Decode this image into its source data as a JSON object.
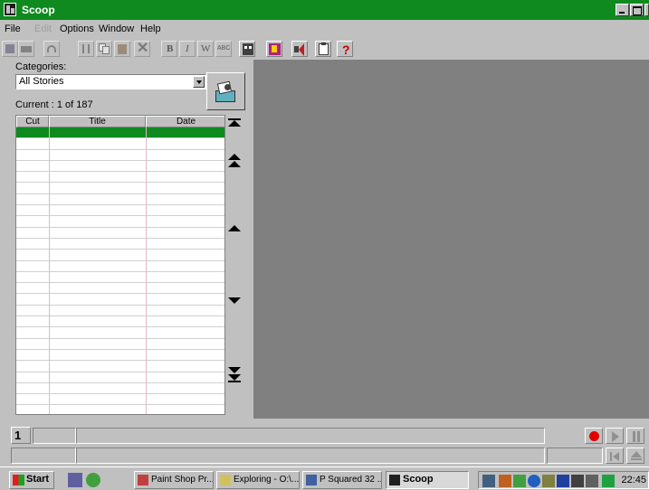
{
  "window": {
    "title": "Scoop"
  },
  "menu": {
    "file": "File",
    "edit": "Edit",
    "options": "Options",
    "window": "Window",
    "help": "Help"
  },
  "toolbar": {
    "buttons": [
      "save-icon",
      "print-icon",
      "undo-icon",
      "cut-icon",
      "copy-icon",
      "paste-icon",
      "delete-icon",
      "bold-icon",
      "italic-icon",
      "word-icon",
      "spell-icon",
      "building-icon",
      "book-icon",
      "speaker-icon",
      "clipboard-icon",
      "help-icon"
    ],
    "bold_glyph": "B",
    "italic_glyph": "I",
    "word_glyph": "W",
    "spell_glyph": "ABC",
    "help_glyph": "?"
  },
  "left_panel": {
    "categories_label": "Categories:",
    "category_value": "All Stories",
    "current_label": "Current : 1 of 187",
    "columns": [
      "Cut",
      "Title",
      "Date"
    ],
    "row_count": 25,
    "selected_row": 0
  },
  "status": {
    "page_number": "1"
  },
  "taskbar": {
    "start_label": "Start",
    "tasks": [
      "Paint Shop Pr...",
      "Exploring - O:\\...",
      "P Squared 32 ...",
      "Scoop"
    ],
    "active_task": "Scoop",
    "clock": "22:45"
  },
  "colors": {
    "accent": "#0f8a1f",
    "workspace": "#808080",
    "face": "#c0c0c0",
    "record": "#e00000"
  }
}
